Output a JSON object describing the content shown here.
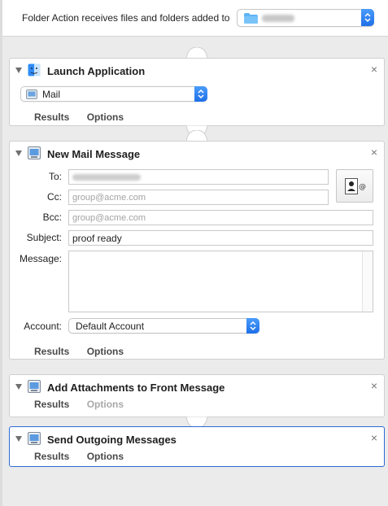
{
  "header": {
    "label": "Folder Action receives files and folders added to",
    "folder_value_redacted": true
  },
  "actions": [
    {
      "title": "Launch Application",
      "icon": "finder-icon",
      "app_popup": "Mail",
      "tabs": [
        "Results",
        "Options"
      ]
    },
    {
      "title": "New Mail Message",
      "icon": "automator-script-icon",
      "fields": {
        "to_label": "To:",
        "cc_label": "Cc:",
        "cc_placeholder": "group@acme.com",
        "bcc_label": "Bcc:",
        "bcc_placeholder": "group@acme.com",
        "subject_label": "Subject:",
        "subject_value": "proof ready",
        "message_label": "Message:",
        "account_label": "Account:",
        "account_value": "Default Account"
      },
      "tabs": [
        "Results",
        "Options"
      ]
    },
    {
      "title": "Add Attachments to Front Message",
      "icon": "automator-script-icon",
      "tabs": [
        "Results",
        "Options"
      ]
    },
    {
      "title": "Send Outgoing Messages",
      "icon": "automator-script-icon",
      "tabs": [
        "Results",
        "Options"
      ]
    }
  ],
  "colors": {
    "accent": "#2d6bd6",
    "popup_arrow": "#1f6fe8",
    "folder": "#5fb4f5"
  },
  "close_glyph": "×"
}
